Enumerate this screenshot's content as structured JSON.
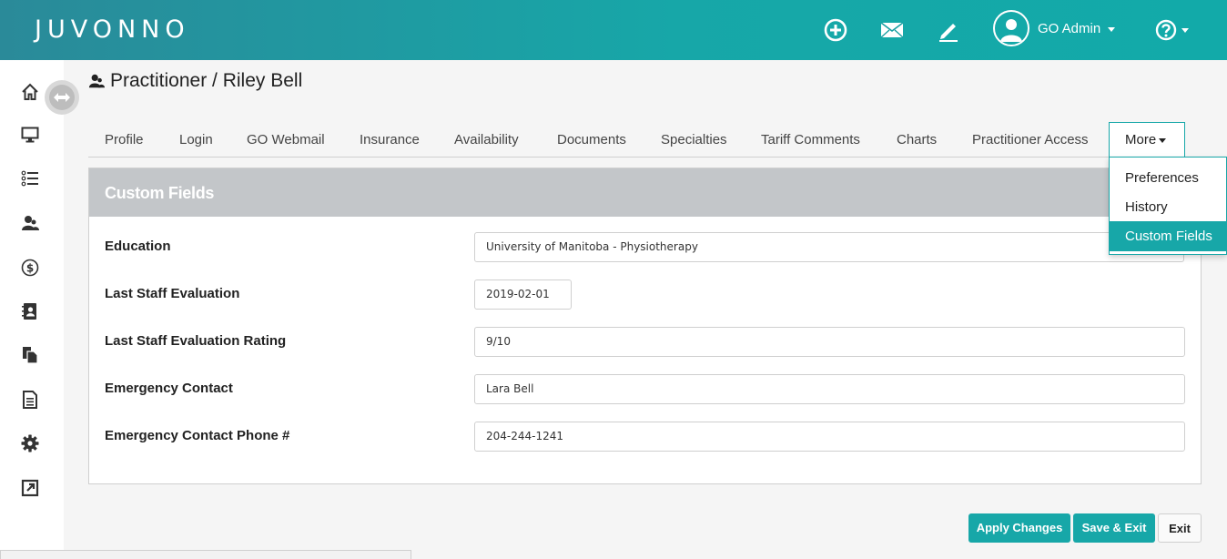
{
  "header": {
    "logo": "JUVONNO",
    "user_name": "GO Admin",
    "icons": [
      "plus-circle-icon",
      "mail-icon",
      "pencil-icon",
      "user-avatar-icon",
      "help-icon"
    ]
  },
  "sidebar": {
    "items": [
      "home-icon",
      "monitor-icon",
      "list-icon",
      "practitioner-icon",
      "dollar-icon",
      "contacts-book-icon",
      "copy-icon",
      "document-icon",
      "gear-icon",
      "external-link-icon"
    ]
  },
  "page": {
    "title": "Practitioner / Riley Bell"
  },
  "tabs": [
    {
      "label": "Profile"
    },
    {
      "label": "Login"
    },
    {
      "label": "GO Webmail"
    },
    {
      "label": "Insurance"
    },
    {
      "label": "Availability"
    },
    {
      "label": "Documents"
    },
    {
      "label": "Specialties"
    },
    {
      "label": "Tariff Comments"
    },
    {
      "label": "Charts"
    },
    {
      "label": "Practitioner Access"
    }
  ],
  "more_tab": {
    "label": "More",
    "items": [
      {
        "label": "Preferences"
      },
      {
        "label": "History"
      },
      {
        "label": "Custom Fields"
      }
    ]
  },
  "panel": {
    "title": "Custom Fields",
    "fields": [
      {
        "label": "Education",
        "value": "University of Manitoba - Physiotherapy"
      },
      {
        "label": "Last Staff Evaluation",
        "value": "2019-02-01"
      },
      {
        "label": "Last Staff Evaluation Rating",
        "value": "9/10"
      },
      {
        "label": "Emergency Contact",
        "value": "Lara Bell"
      },
      {
        "label": "Emergency Contact Phone #",
        "value": "204-244-1241"
      }
    ]
  },
  "actions": {
    "apply": "Apply Changes",
    "save_exit": "Save & Exit",
    "exit": "Exit"
  },
  "colors": {
    "accent": "#17a7a8",
    "header_start": "#2a8a99",
    "panel_header": "#c3c6c9"
  }
}
